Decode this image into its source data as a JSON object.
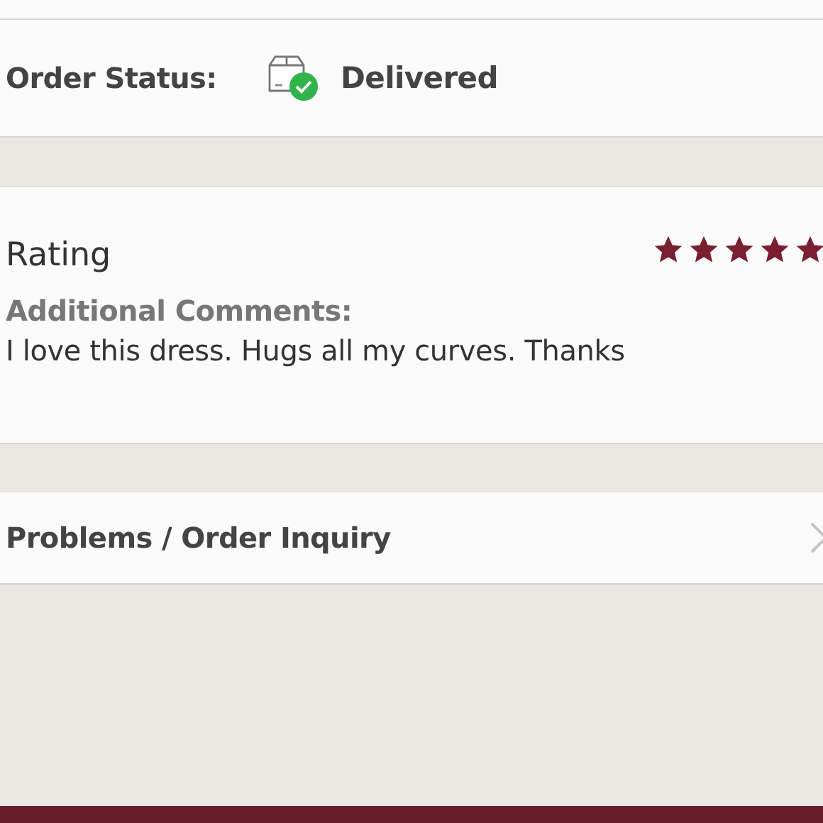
{
  "order_status": {
    "label": "Order Status:",
    "status": "Delivered",
    "delivered": true
  },
  "rating": {
    "title": "Rating",
    "stars": 5,
    "comments_label": "Additional Comments:",
    "comments": "I love this dress. Hugs all my curves. Thanks"
  },
  "inquiry": {
    "label": "Problems / Order Inquiry"
  }
}
